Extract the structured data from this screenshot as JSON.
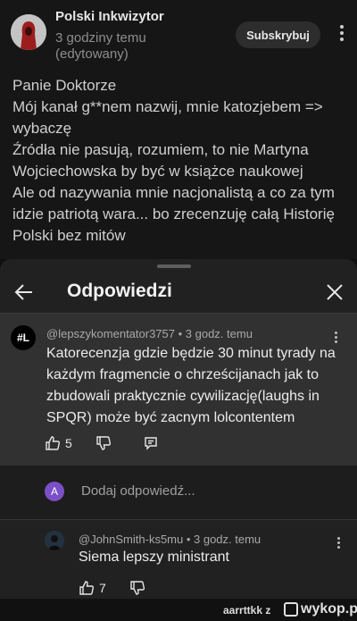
{
  "comment": {
    "author": "Polski Inkwizytor",
    "time": "3 godziny temu (edytowany)",
    "subscribe_label": "Subskrybuj",
    "lines": [
      "Panie Doktorze",
      "Mój kanał g**nem nazwij, mnie katozjebem => wybaczę",
      "Źródła nie pasują, rozumiem, to nie Martyna Wojciechowska by być w książce naukowej",
      "Ale od nazywania mnie nacjonalistą a co za tym idzie patriotą wara... bo zrecenzuję całą Historię Polski bez mitów"
    ]
  },
  "sheet": {
    "title": "Odpowiedzi"
  },
  "reply": {
    "avatar_text": "#L",
    "meta": "@lepszykomentator3757 • 3 godz. temu",
    "text": "Katorecenzja gdzie będzie 30 minut tyrady na każdym fragmencie o chrześcijanach jak to zbudowali praktycznie cywilizację(laughs in SPQR) może być zacnym lolcontentem",
    "likes": "5"
  },
  "add_reply": {
    "avatar_letter": "A",
    "placeholder": "Dodaj odpowiedź..."
  },
  "reply2": {
    "meta": "@JohnSmith-ks5mu • 3 godz. temu",
    "text": "Siema lepszy ministrant",
    "likes": "7"
  },
  "watermark": {
    "user": "aarrttkk",
    "separator": "z",
    "site": "wykop.pl"
  }
}
